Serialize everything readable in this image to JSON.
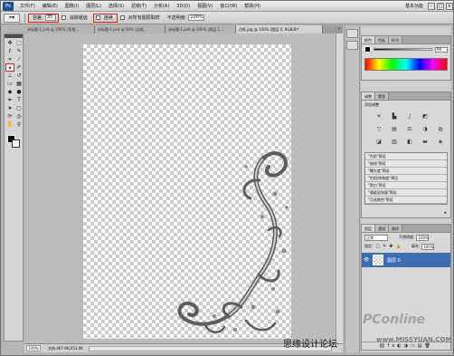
{
  "app": {
    "logo": "Ps"
  },
  "menubar": {
    "items": [
      "文件(F)",
      "编辑(E)",
      "图像(I)",
      "图层(L)",
      "选择(S)",
      "滤镜(T)",
      "分析(A)",
      "3D(D)",
      "视图(V)",
      "窗口(W)",
      "帮助(H)"
    ],
    "workspace": "基本功能"
  },
  "options": {
    "tolerance_label": "容差:",
    "tolerance_value": "35",
    "antialias_label": "消除锯齿",
    "contiguous_label": "连续",
    "sample_all_label": "对所有图层取样",
    "opacity_label": "不透明度:",
    "opacity_value": "100%"
  },
  "tabs": [
    "未标题-1.psd @ 100% (背景...",
    "未标题-1.psd @ 50% (边框...",
    "未标题-1.psd @ 100% (图层 1...",
    "边框.jpg @ 100% (图层 0, RGB/8)*"
  ],
  "color_panel": {
    "tabs": [
      "颜色",
      "色板",
      "样式"
    ],
    "value": "99"
  },
  "adjustments_panel": {
    "tabs": [
      "调整",
      "蒙版"
    ],
    "title": "添加调整",
    "presets": [
      "\"色阶\"预设",
      "\"曲线\"预设",
      "\"曝光度\"预设",
      "\"色相/饱和度\"预设",
      "\"黑白\"预设",
      "\"通道混和器\"预设",
      "\"可选颜色\"预设"
    ]
  },
  "layers_panel": {
    "tabs": [
      "图层",
      "通道",
      "路径"
    ],
    "blend_mode": "正常",
    "opacity_label": "不透明度:",
    "opacity_value": "100%",
    "lock_label": "锁定:",
    "fill_label": "填充:",
    "fill_value": "100%",
    "layer_name": "图层 0"
  },
  "status": {
    "zoom": "100%",
    "doc_size": "文档:467.9K/253.0K"
  },
  "watermark": {
    "logo": "PConline",
    "text": "思缘设计论坛",
    "url": "www.MISSYUAN.COM"
  }
}
